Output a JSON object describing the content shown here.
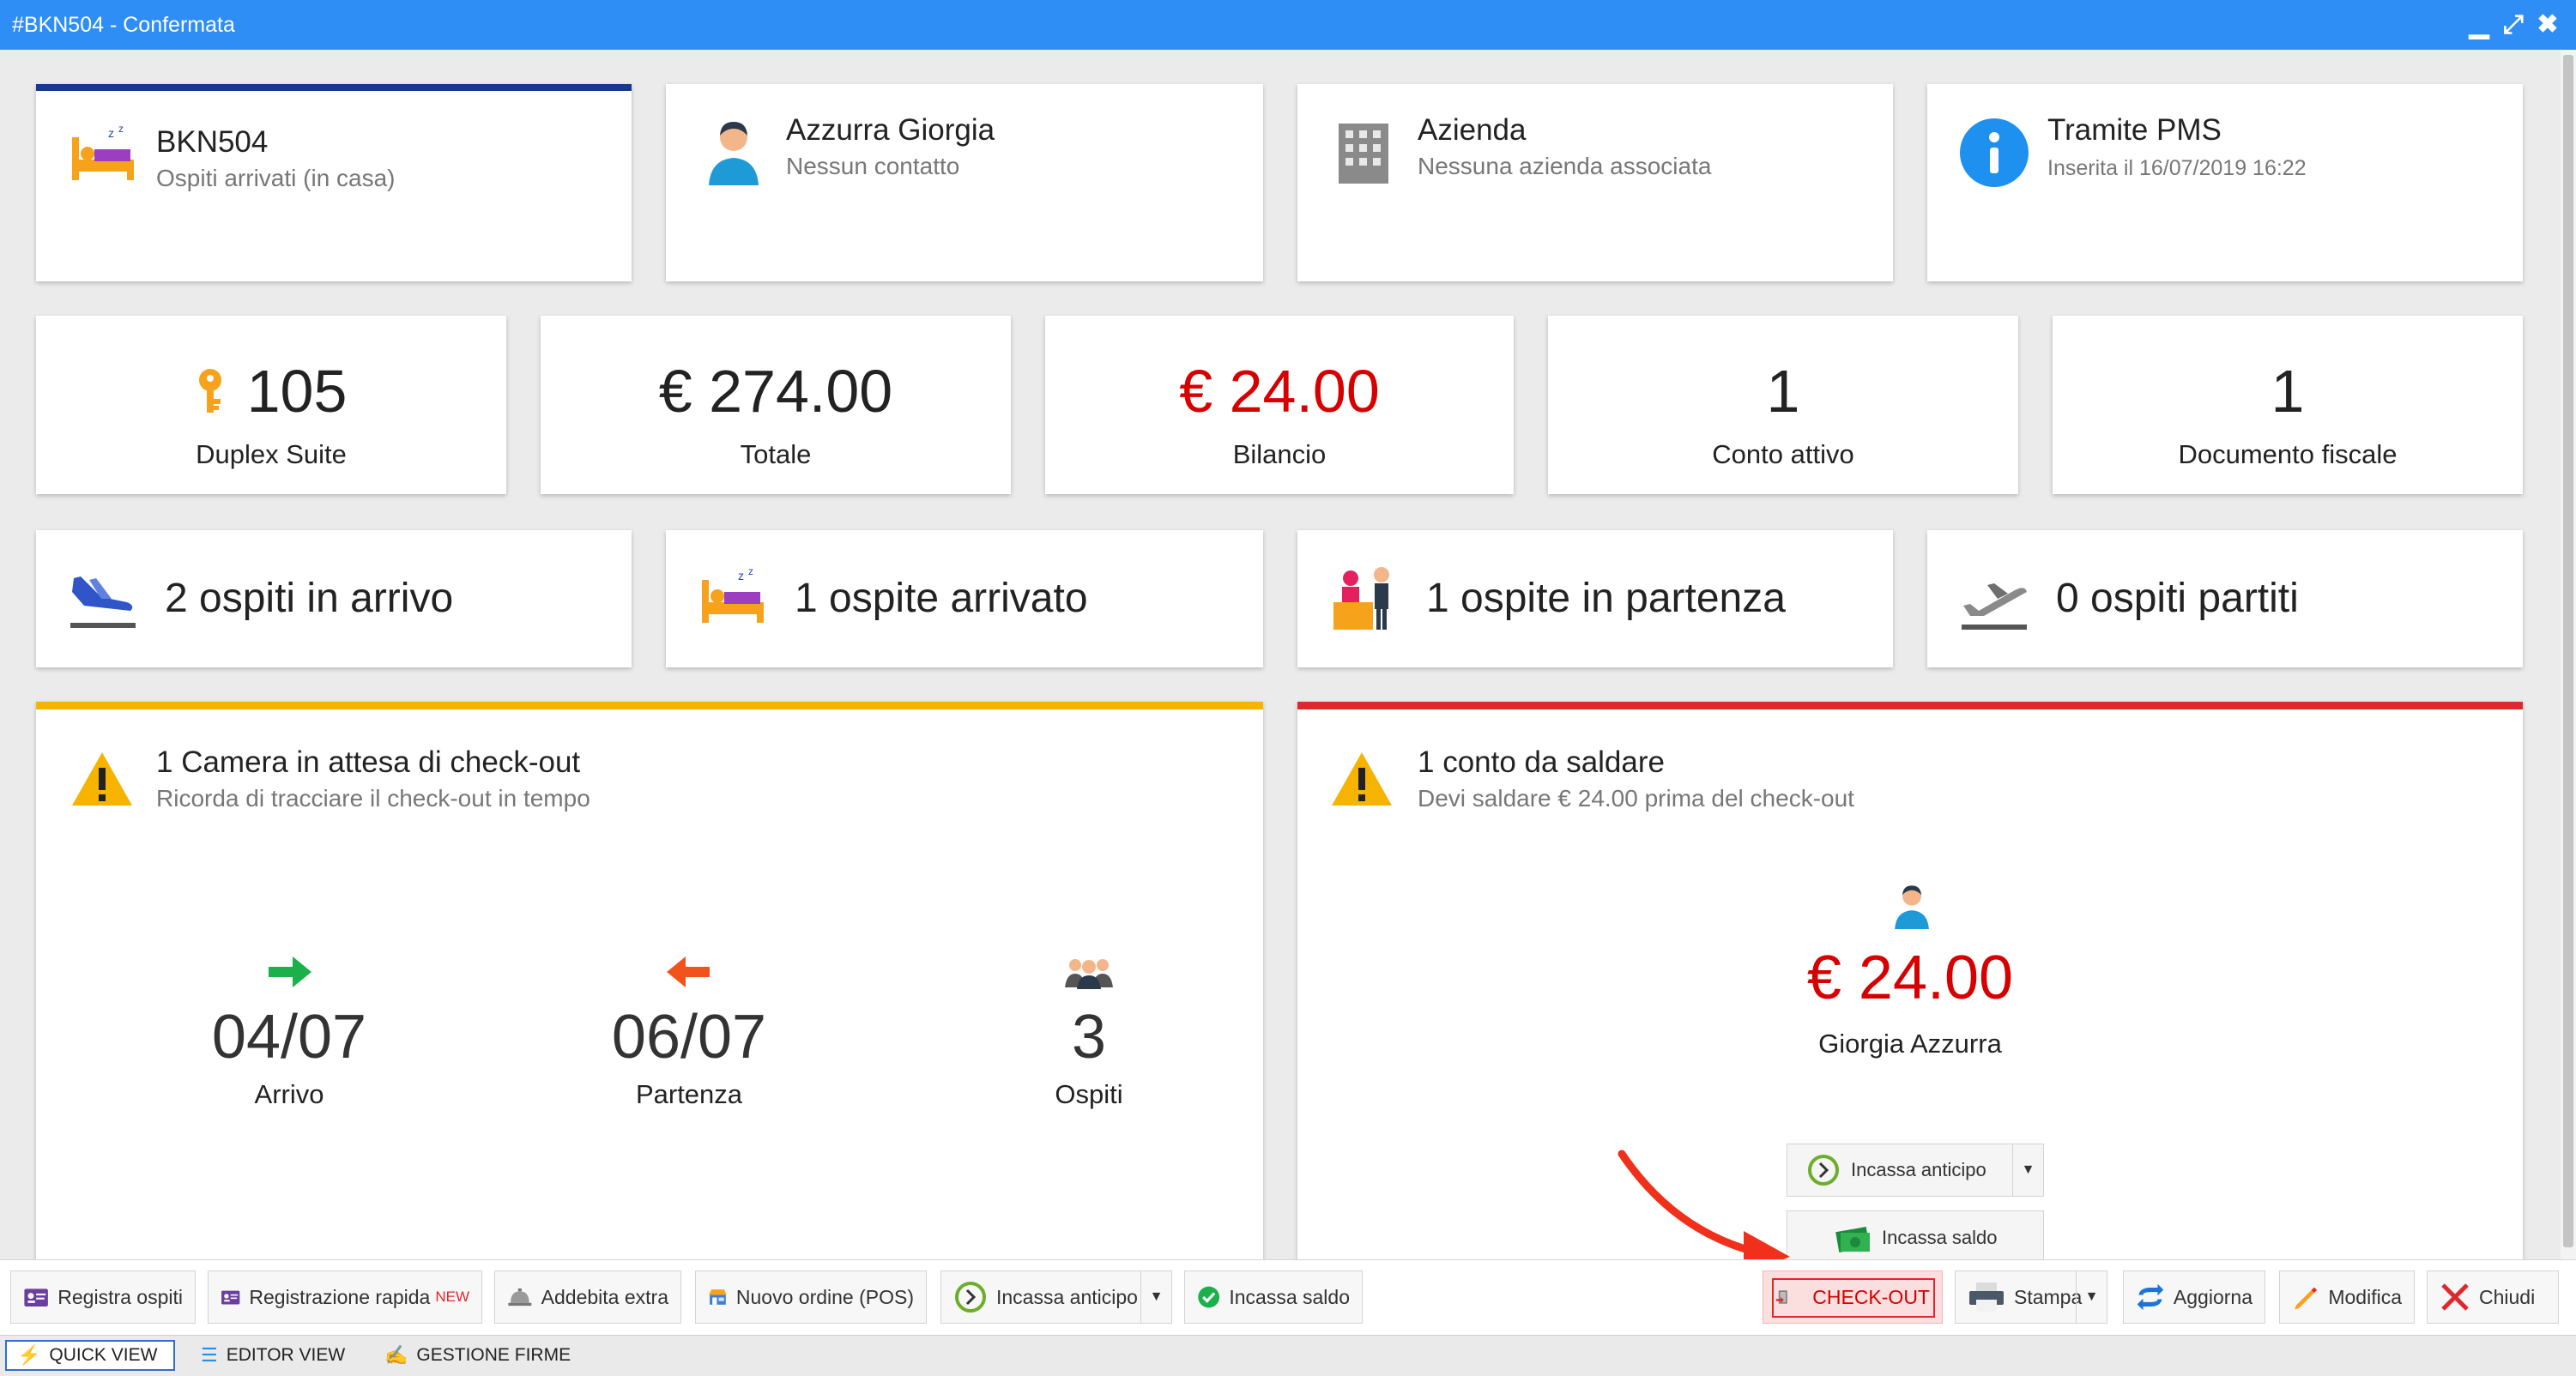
{
  "window": {
    "title": "#BKN504 - Confermata",
    "min": "▁",
    "max": "⤢",
    "close": "✖"
  },
  "top_cards": {
    "booking": {
      "title": "BKN504",
      "sub": "Ospiti arrivati (in casa)"
    },
    "guest": {
      "title": "Azzurra Giorgia",
      "sub": "Nessun contatto"
    },
    "company": {
      "title": "Azienda",
      "sub": "Nessuna azienda associata"
    },
    "source": {
      "title": "Tramite PMS",
      "sub": "Inserita il 16/07/2019 16:22"
    }
  },
  "stats": {
    "room": {
      "value": "105",
      "label": "Duplex Suite"
    },
    "total": {
      "value": "€ 274.00",
      "label": "Totale"
    },
    "balance": {
      "value": "€ 24.00",
      "label": "Bilancio",
      "color": "#d60000"
    },
    "accounts": {
      "value": "1",
      "label": "Conto attivo"
    },
    "docs": {
      "value": "1",
      "label": "Documento fiscale"
    }
  },
  "guests": {
    "arriving": "2 ospiti in arrivo",
    "arrived": "1 ospite arrivato",
    "departing": "1 ospite in partenza",
    "departed": "0 ospiti partiti"
  },
  "checkout_panel": {
    "title": "1 Camera in attesa di check-out",
    "sub": "Ricorda di tracciare il check-out in tempo",
    "arrival": {
      "value": "04/07",
      "label": "Arrivo"
    },
    "departure": {
      "value": "06/07",
      "label": "Partenza"
    },
    "guests": {
      "value": "3",
      "label": "Ospiti"
    }
  },
  "balance_panel": {
    "title": "1 conto da saldare",
    "sub": "Devi saldare € 24.00 prima del check-out",
    "amount": "€ 24.00",
    "name": "Giorgia Azzurra",
    "advance_button": "Incassa anticipo",
    "balance_button": "Incassa saldo"
  },
  "toolbar": {
    "register": "Registra ospiti",
    "quick_register": "Registrazione rapida",
    "new_badge": "NEW",
    "extra": "Addebita extra",
    "order": "Nuovo ordine (POS)",
    "advance": "Incassa anticipo",
    "settle": "Incassa saldo",
    "checkout": "CHECK-OUT",
    "print": "Stampa",
    "refresh": "Aggiorna",
    "edit": "Modifica",
    "close": "Chiudi"
  },
  "statusbar": {
    "quick": "QUICK VIEW",
    "editor": "EDITOR VIEW",
    "signatures": "GESTIONE FIRME"
  },
  "colors": {
    "titlebar": "#2e8ef5",
    "navy": "#17398c",
    "warning": "#f6b400",
    "danger": "#e0282c",
    "red_text": "#d60000"
  }
}
